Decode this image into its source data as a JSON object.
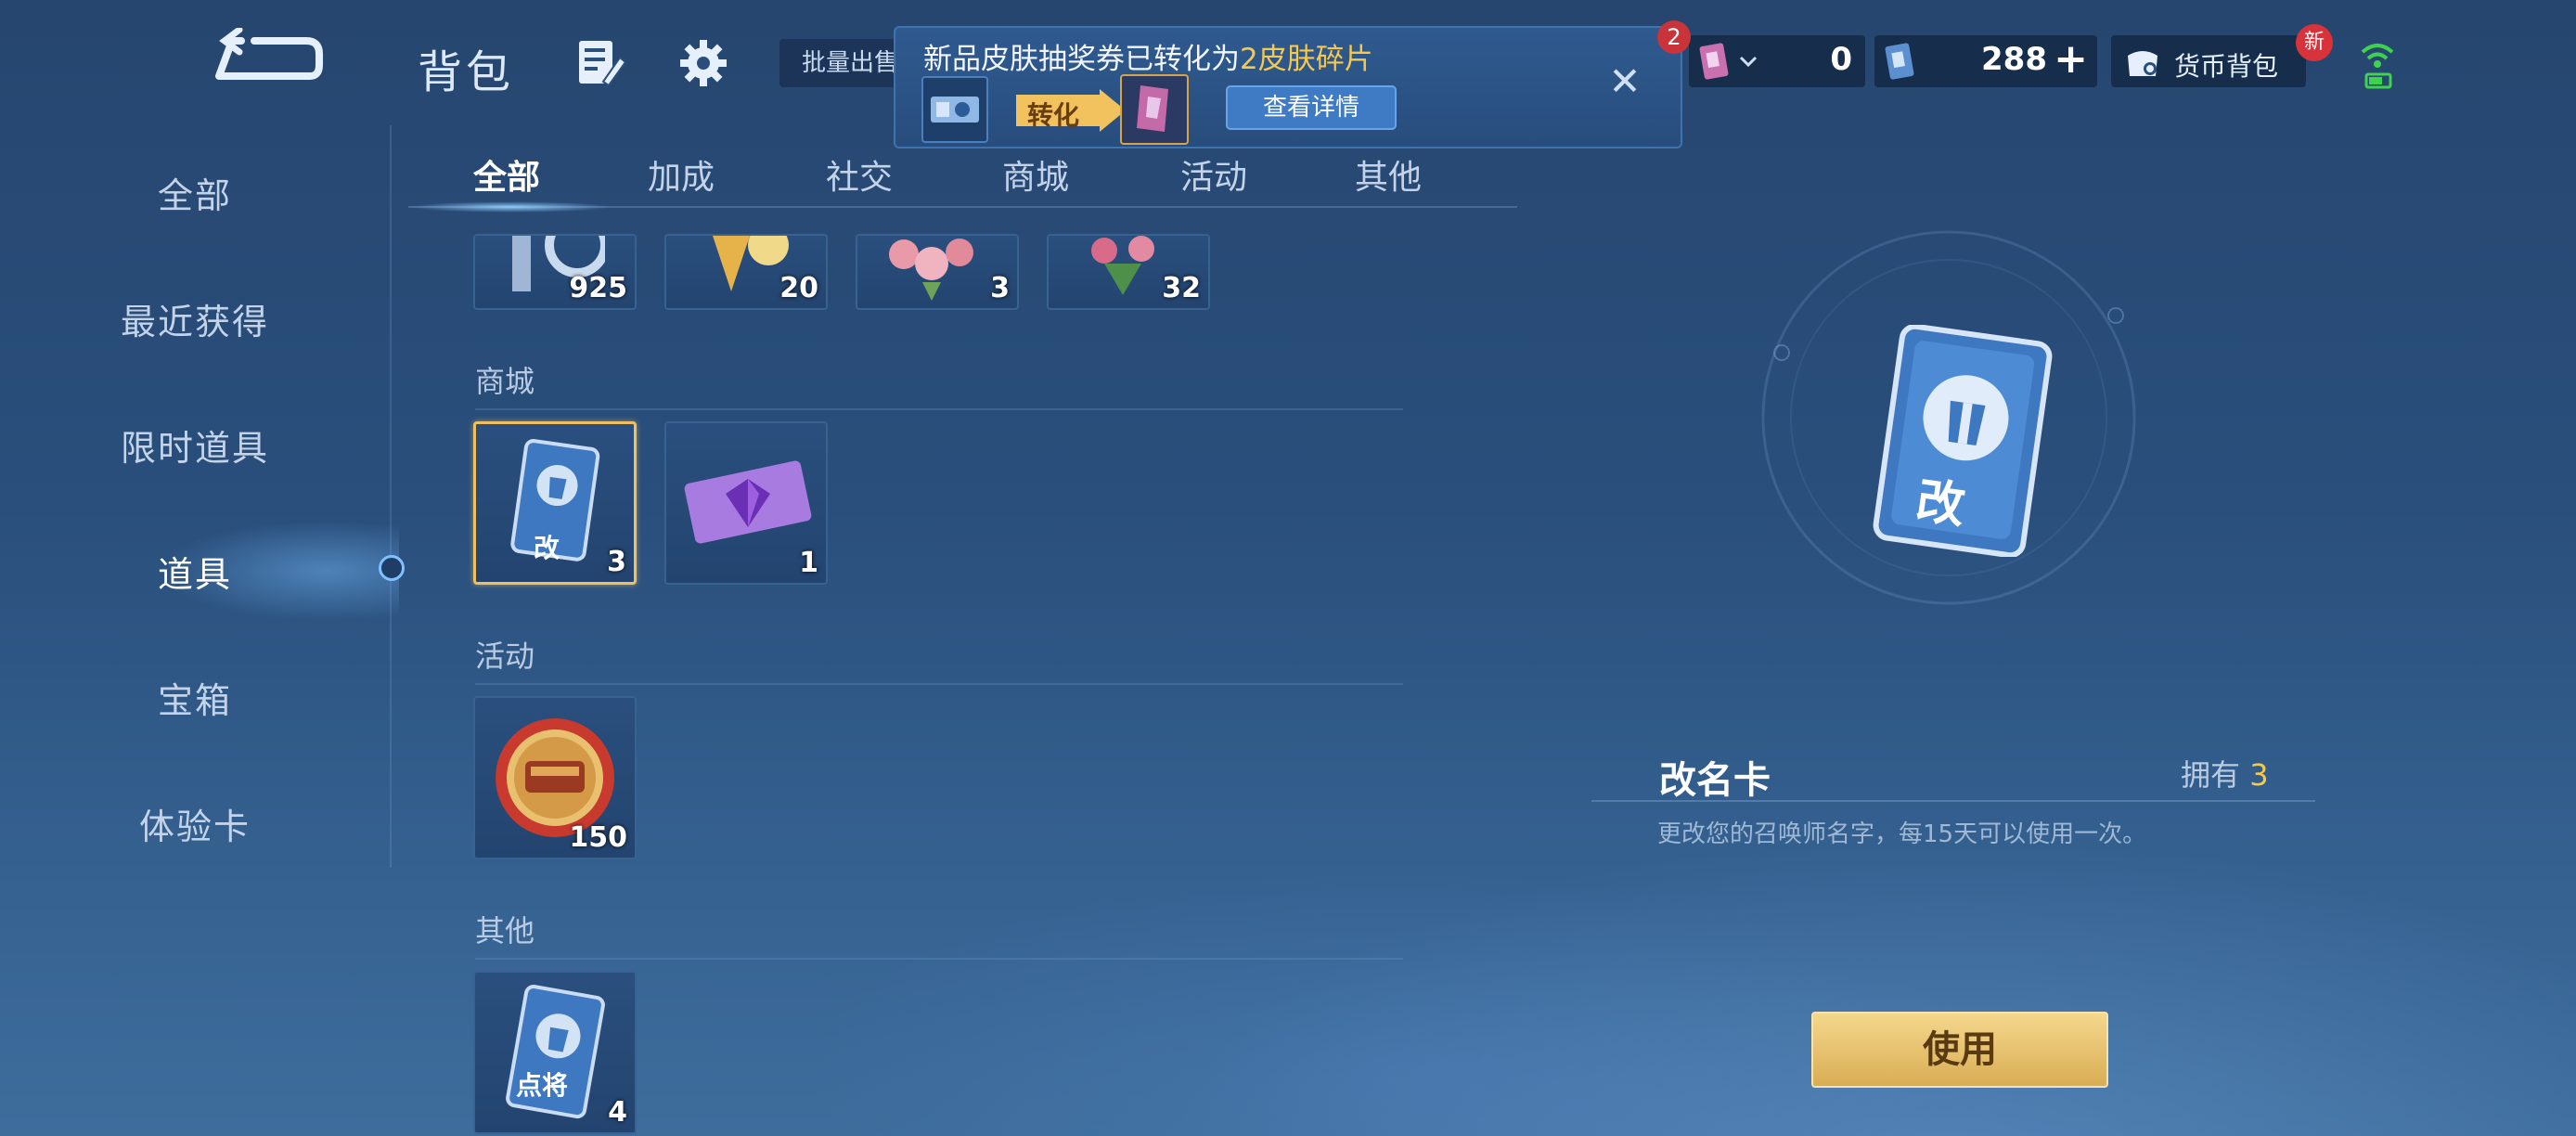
{
  "header": {
    "title": "背包",
    "batch_label": "批量出售"
  },
  "notification": {
    "title_prefix": "新品皮肤抽奖券已转化为",
    "title_highlight": "2皮肤碎片",
    "convert_label": "转化",
    "details_label": "查看详情",
    "close_glyph": "✕"
  },
  "currency": {
    "badge_count": "2",
    "value1": "0",
    "value2": "288",
    "plus_glyph": "+",
    "wallet_label": "货币背包",
    "new_badge": "新"
  },
  "nav": {
    "items": [
      "全部",
      "最近获得",
      "限时道具",
      "道具",
      "宝箱",
      "体验卡"
    ],
    "active_index": 3
  },
  "tabs": [
    "全部",
    "加成",
    "社交",
    "商城",
    "活动",
    "其他"
  ],
  "sections": {
    "top_counts": [
      "925",
      "20",
      "3",
      "32"
    ],
    "shop_label": "商城",
    "shop_counts": [
      "3",
      "1"
    ],
    "event_label": "活动",
    "event_counts": [
      "150"
    ],
    "other_label": "其他",
    "other_counts": [
      "4"
    ]
  },
  "card_text": {
    "rename": "改",
    "hero": "点将"
  },
  "detail": {
    "name": "改名卡",
    "own_label": "拥有",
    "own_count": "3",
    "description": "更改您的召唤师名字，每15天可以使用一次。",
    "use_label": "使用"
  },
  "colors": {
    "accent_gold": "#f5c84f",
    "use_button": "#e6c270",
    "badge_red": "#c9343a"
  }
}
